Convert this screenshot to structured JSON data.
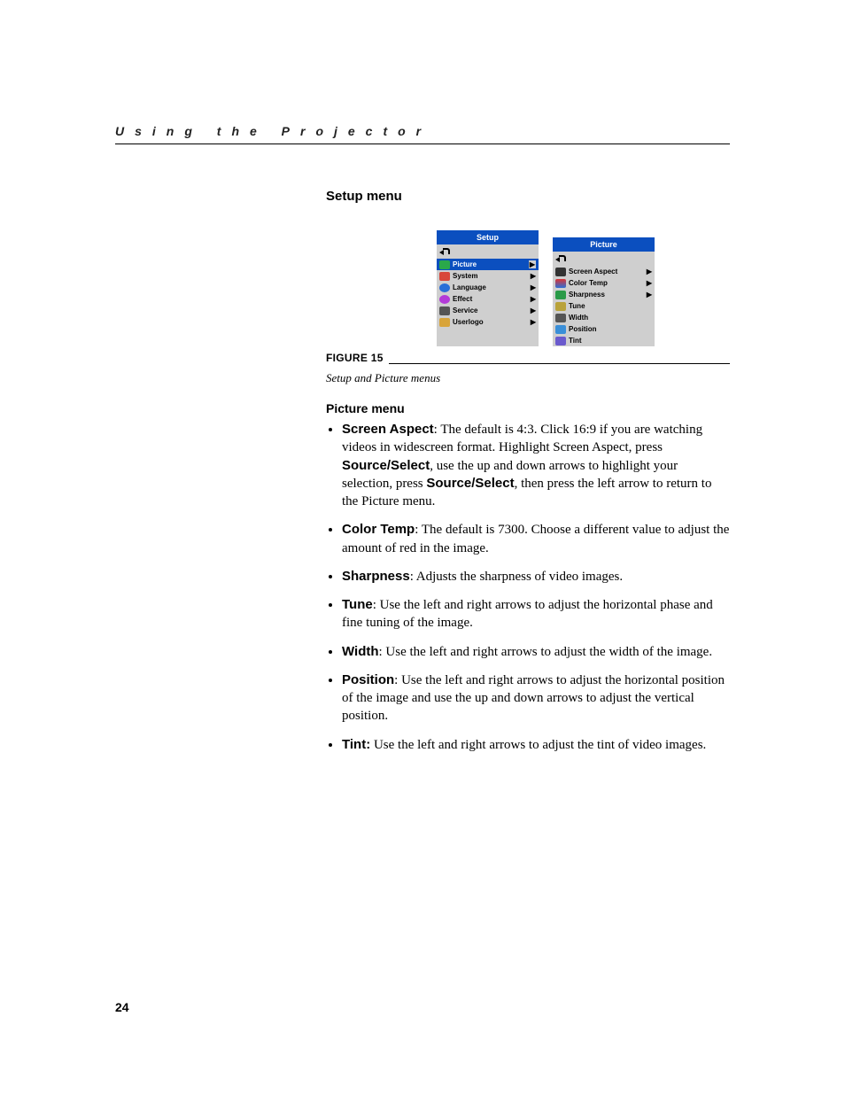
{
  "header": {
    "running": "Using the Projector"
  },
  "section_title": "Setup menu",
  "figure": {
    "label": "FIGURE 15",
    "caption": "Setup and Picture menus"
  },
  "osd": {
    "setup": {
      "title": "Setup",
      "items": [
        {
          "label": "Picture",
          "selected": true
        },
        {
          "label": "System"
        },
        {
          "label": "Language"
        },
        {
          "label": "Effect"
        },
        {
          "label": "Service"
        },
        {
          "label": "Userlogo"
        }
      ]
    },
    "picture": {
      "title": "Picture",
      "items": [
        {
          "label": "Screen Aspect",
          "arrow": true
        },
        {
          "label": "Color Temp",
          "arrow": true
        },
        {
          "label": "Sharpness",
          "arrow": true
        },
        {
          "label": "Tune"
        },
        {
          "label": "Width"
        },
        {
          "label": "Position"
        },
        {
          "label": "Tint"
        }
      ]
    }
  },
  "picture_menu": {
    "heading": "Picture menu",
    "items": [
      {
        "term": "Screen Aspect",
        "text_a": ": The default is 4:3. Click 16:9 if you are watching videos in widescreen format. Highlight Screen Aspect, press ",
        "bold_b": "Source/Select",
        "text_b": ", use the up and down arrows to highlight your selection, press ",
        "bold_c": "Source/Select",
        "text_c": ", then press the left arrow to return to the Picture menu."
      },
      {
        "term": "Color Temp",
        "text_a": ": The default is 7300. Choose a different value to adjust the amount of red in the image."
      },
      {
        "term": "Sharpness",
        "text_a": ": Adjusts the sharpness of video images."
      },
      {
        "term": "Tune",
        "text_a": ": Use the left and right arrows to adjust the horizontal phase and fine tuning of the image."
      },
      {
        "term": "Width",
        "text_a": ": Use the left and right arrows to adjust the width of the image."
      },
      {
        "term": "Position",
        "text_a": ": Use the left and right arrows to adjust the horizontal position of the image and use the up and down arrows to adjust the vertical position."
      },
      {
        "term": "Tint:",
        "text_a": " Use the left and right arrows to adjust the tint of video images."
      }
    ]
  },
  "page_number": "24",
  "colors": {
    "setup_icons": [
      "#2aa84a",
      "#d8463a",
      "#2a6fd8",
      "#b33bd8",
      "#555",
      "#d8a43a"
    ],
    "picture_icons": [
      "#333",
      "#2aa84a",
      "#2a9a48",
      "#b9a23a",
      "#555",
      "#3a8fd8",
      "#6a5acd"
    ]
  }
}
